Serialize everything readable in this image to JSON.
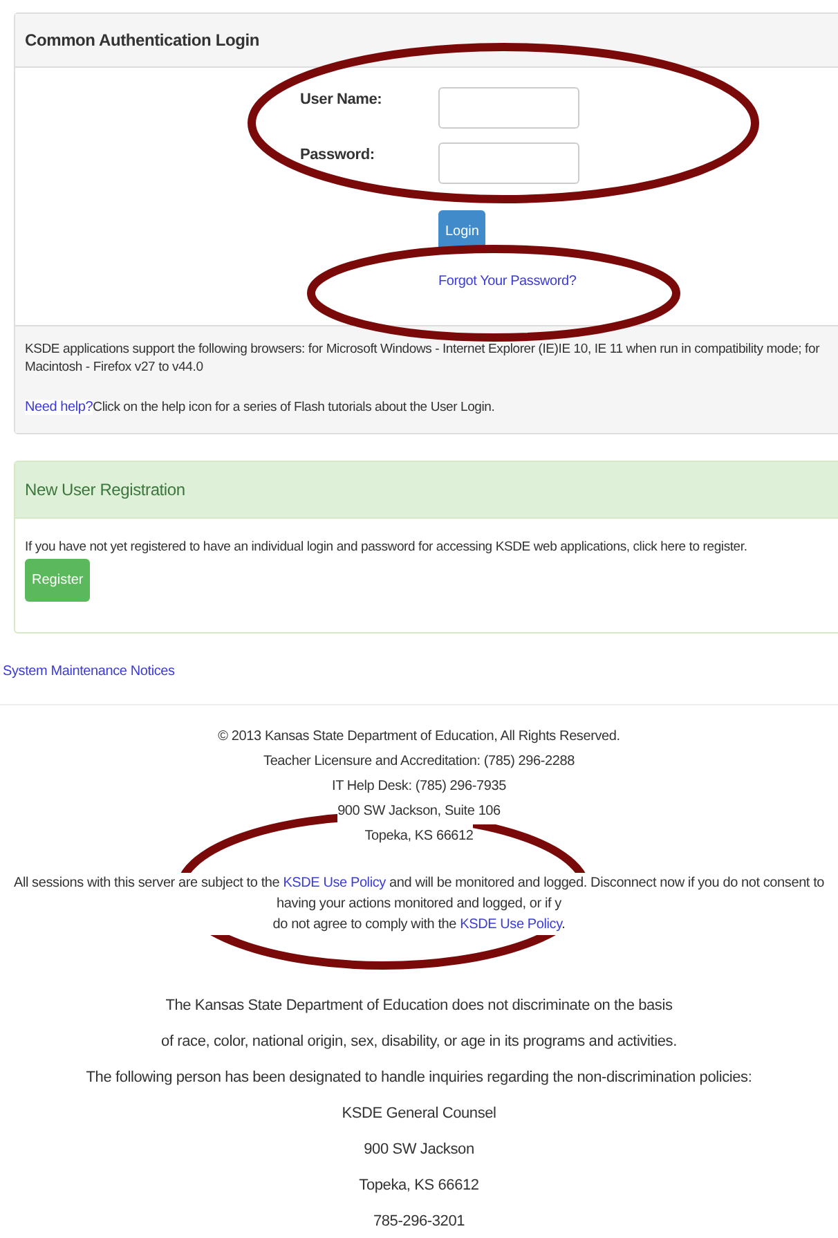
{
  "login_panel": {
    "title": "Common Authentication Login",
    "fields": [
      {
        "label": "User Name:"
      },
      {
        "label": "Password:"
      }
    ],
    "login_button": "Login",
    "forgot_link": "Forgot Your Password?",
    "browsers_note": "KSDE applications support the following browsers: for Microsoft Windows - Internet Explorer (IE)IE 10, IE 11 when run in compatibility mode; for Macintosh - Firefox v27 to v44.0",
    "help_link": "Need help?",
    "help_text": "Click on the help icon for a series of Flash tutorials about the User Login."
  },
  "registration_panel": {
    "title": "New User Registration",
    "text": "If you have not yet registered to have an individual login and password for accessing KSDE web applications, click here to register.",
    "register_button": "Register"
  },
  "maintenance_link": "System Maintenance Notices",
  "footer": {
    "contact_lines": [
      "© 2013 Kansas State Department of Education, All Rights Reserved.",
      "Teacher Licensure and Accreditation: (785) 296-2288",
      "IT Help Desk: (785) 296-7935",
      "900 SW Jackson, Suite 106",
      "Topeka, KS 66612"
    ],
    "policy_lines": [
      [
        {
          "kind": "text",
          "text": "All sessions with this server are subject to the "
        },
        {
          "kind": "link",
          "text": "KSDE Use Policy"
        },
        {
          "kind": "text",
          "text": " and will be monitored and logged. Disconnect now if you do not consent to having your actions monitored and logged, or if y"
        }
      ],
      [
        {
          "kind": "text",
          "text": "do not agree to comply with the "
        },
        {
          "kind": "link",
          "text": "KSDE Use Policy"
        },
        {
          "kind": "text",
          "text": "."
        }
      ]
    ],
    "nondiscrimination_lines": [
      "The Kansas State Department of Education does not discriminate on the basis",
      "of race, color, national origin, sex, disability, or age in its programs and activities.",
      "The following person has been designated to handle inquiries regarding the non-discrimination policies:",
      "KSDE General Counsel",
      "900 SW Jackson",
      "Topeka, KS 66612",
      "785-296-3201"
    ]
  }
}
